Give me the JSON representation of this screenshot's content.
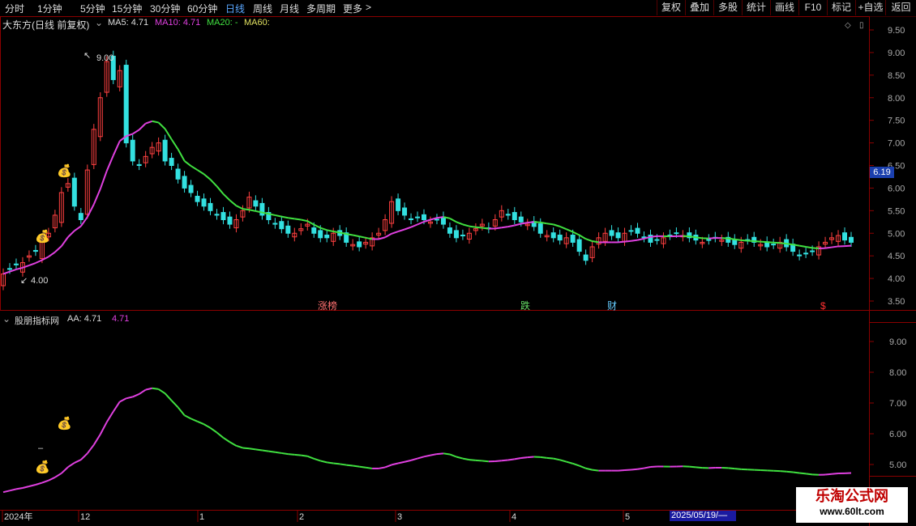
{
  "toolbar": {
    "tabs": [
      "分时",
      "1分钟",
      "5分钟",
      "15分钟",
      "30分钟",
      "60分钟",
      "日线",
      "周线",
      "月线",
      "多周期",
      "更多"
    ],
    "active_tab": "日线",
    "more_arrow": ">",
    "right_buttons": [
      "复权",
      "叠加",
      "多股",
      "统计",
      "画线",
      "F10",
      "标记",
      "+自选",
      "返回"
    ]
  },
  "main_panel": {
    "stock_title": "大东方(日线 前复权)",
    "ma5": "MA5: 4.71",
    "ma10": "MA10: 4.71",
    "ma20": "MA20: -",
    "ma60": "MA60:",
    "price_axis": [
      "9.50",
      "9.00",
      "8.50",
      "8.00",
      "7.50",
      "7.00",
      "6.50",
      "6.00",
      "5.50",
      "5.00",
      "4.50",
      "4.00",
      "3.50"
    ],
    "current_price": "6.19",
    "high_label": "9.00",
    "low_label": "4.00",
    "signal_labels": [
      {
        "text": "涨榜",
        "color": "#ff7070"
      },
      {
        "text": "跌",
        "color": "#66dd66"
      },
      {
        "text": "财",
        "color": "#66ccff"
      },
      {
        "text": "$",
        "color": "#ff3030"
      }
    ]
  },
  "indicator_panel": {
    "title": "股朋指标网",
    "aa_label": "AA: 4.71",
    "aa_value": "4.71",
    "axis": [
      "9.00",
      "8.00",
      "7.00",
      "6.00",
      "5.00"
    ]
  },
  "time_axis": {
    "labels": [
      "2024年",
      "12",
      "1",
      "2",
      "3",
      "4",
      "5"
    ],
    "selected_date": "2025/05/19/—"
  },
  "watermark": {
    "line1": "乐淘公式网",
    "line2": "www.60lt.com"
  },
  "colors": {
    "up": "#ff4040",
    "down": "#33e0e0",
    "ma_rising": "#e040e0",
    "ma_falling": "#40e040",
    "grid_border": "#8b0000"
  }
}
